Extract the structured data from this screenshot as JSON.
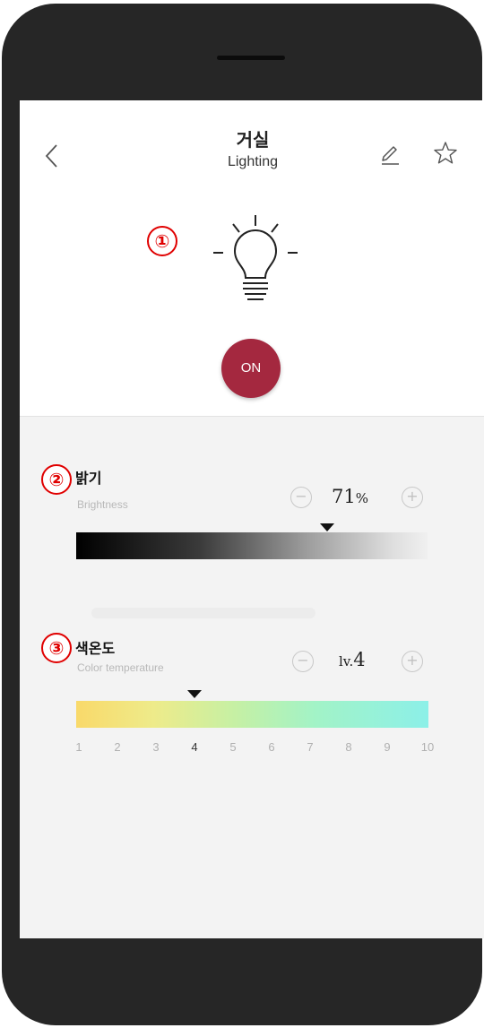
{
  "header": {
    "title_ko": "거실",
    "title_en": "Lighting",
    "back_icon": "chevron-left-icon",
    "edit_icon": "pencil-icon",
    "favorite_icon": "star-outline-icon"
  },
  "markers": [
    "①",
    "②",
    "③"
  ],
  "power": {
    "label": "ON",
    "color": "#a4283f"
  },
  "brightness": {
    "label_ko": "밝기",
    "label_en": "Brightness",
    "value": "71",
    "unit": "%",
    "level": 0.71,
    "minus": "−",
    "plus": "+"
  },
  "color_temperature": {
    "label_ko": "색온도",
    "label_en": "Color temperature",
    "prefix": "lv.",
    "value": "4",
    "minus": "−",
    "plus": "+",
    "ticks": [
      "1",
      "2",
      "3",
      "4",
      "5",
      "6",
      "7",
      "8",
      "9",
      "10"
    ],
    "selected_index": 3
  },
  "colors": {
    "marker": "#e00000",
    "accent": "#a4283f"
  }
}
